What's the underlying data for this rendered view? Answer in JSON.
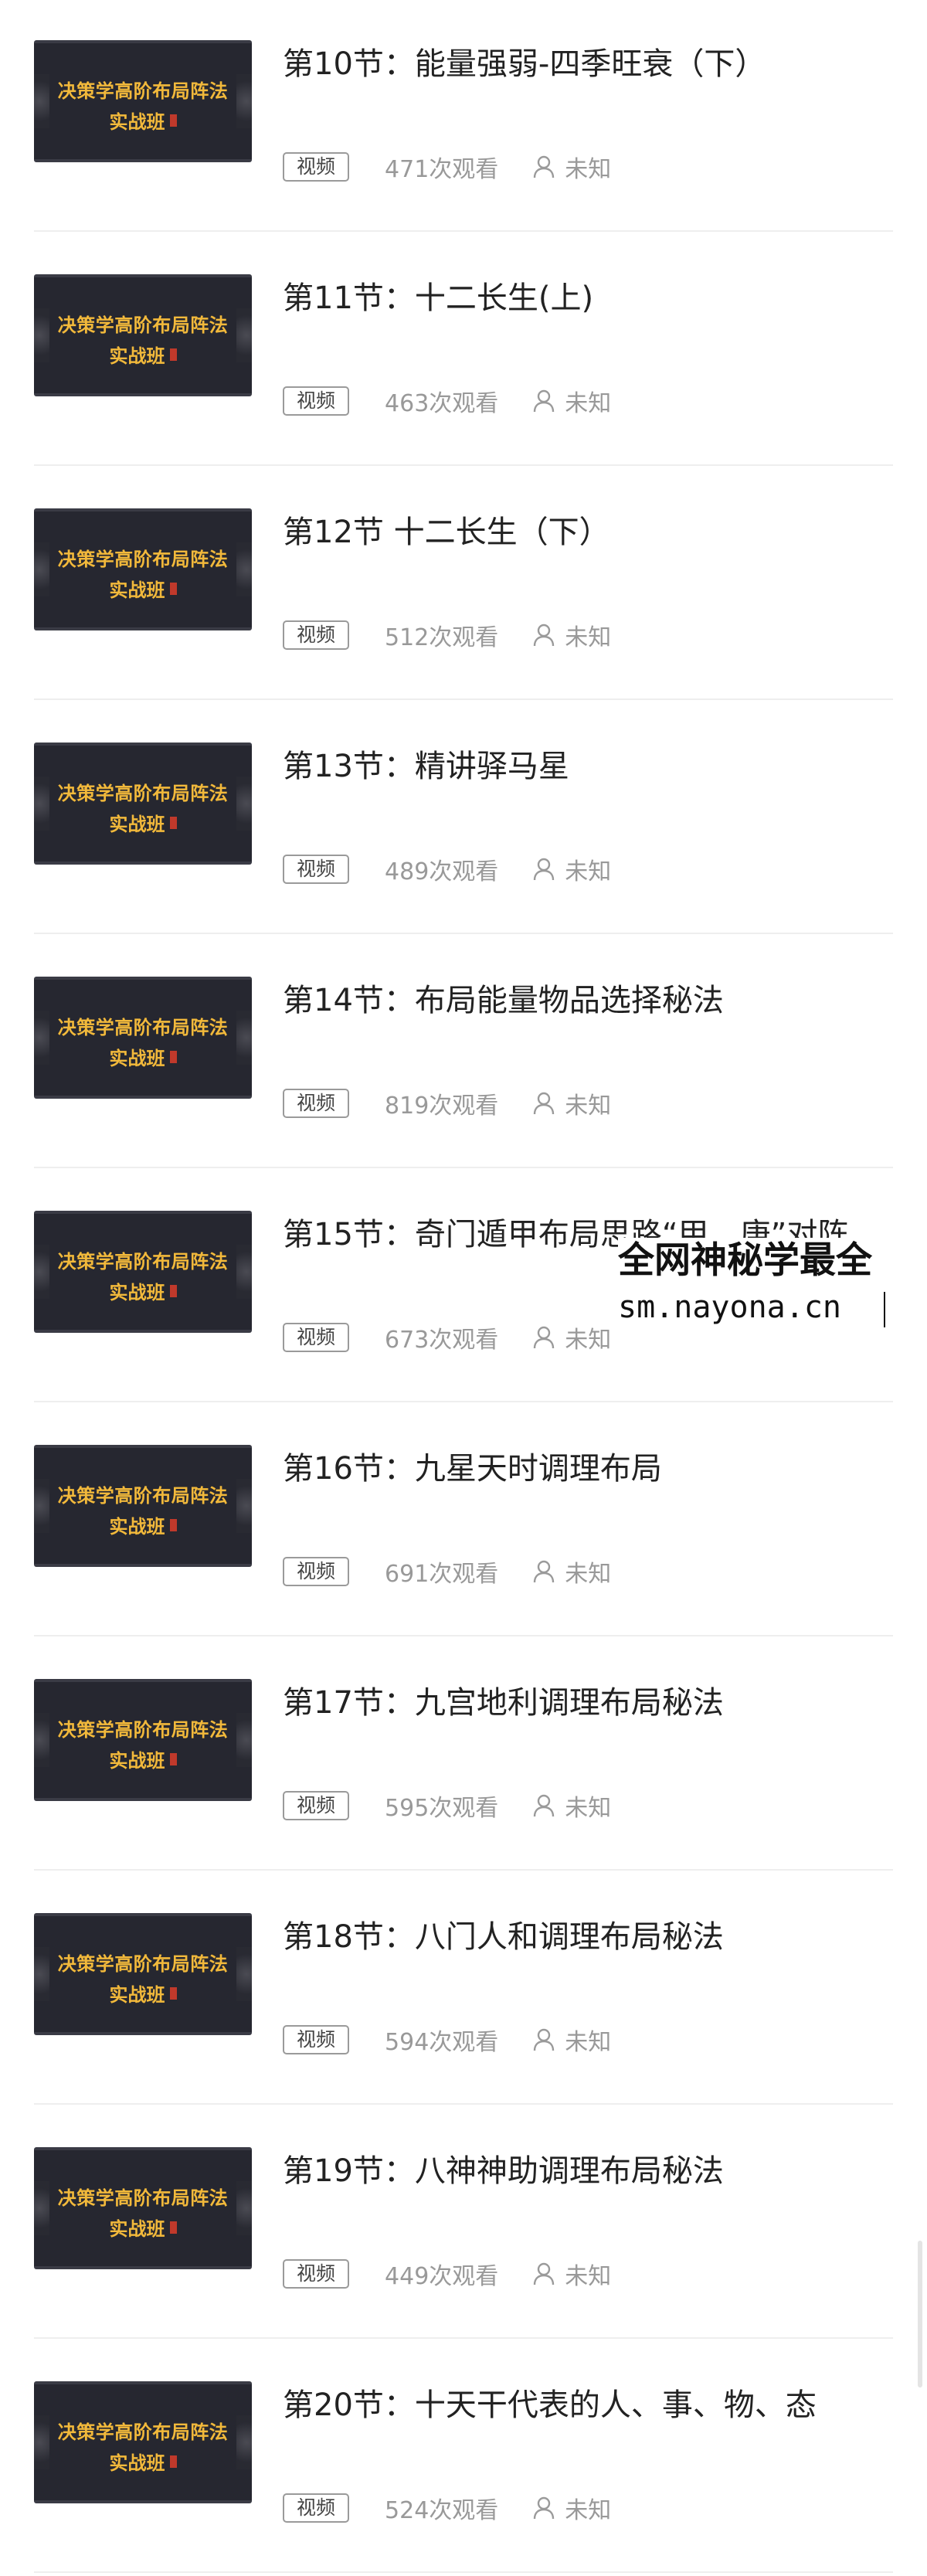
{
  "thumbnail": {
    "line1": "决策学高阶布局阵法",
    "line2": "实战班"
  },
  "lessons": [
    {
      "title": "第10节：能量强弱-四季旺衰（下）",
      "tag": "视频",
      "views": "471次观看",
      "author": "未知"
    },
    {
      "title": "第11节：十二长生(上)",
      "tag": "视频",
      "views": "463次观看",
      "author": "未知"
    },
    {
      "title": "第12节 十二长生（下）",
      "tag": "视频",
      "views": "512次观看",
      "author": "未知"
    },
    {
      "title": "第13节：精讲驿马星",
      "tag": "视频",
      "views": "489次观看",
      "author": "未知"
    },
    {
      "title": "第14节：布局能量物品选择秘法",
      "tag": "视频",
      "views": "819次观看",
      "author": "未知"
    },
    {
      "title": "第15节：奇门遁甲布局思路“甲、庚”对阵",
      "tag": "视频",
      "views": "673次观看",
      "author": "未知"
    },
    {
      "title": "第16节：九星天时调理布局",
      "tag": "视频",
      "views": "691次观看",
      "author": "未知"
    },
    {
      "title": "第17节：九宫地利调理布局秘法",
      "tag": "视频",
      "views": "595次观看",
      "author": "未知"
    },
    {
      "title": "第18节：八门人和调理布局秘法",
      "tag": "视频",
      "views": "594次观看",
      "author": "未知"
    },
    {
      "title": "第19节：八神神助调理布局秘法",
      "tag": "视频",
      "views": "449次观看",
      "author": "未知"
    },
    {
      "title": "第20节：十天干代表的人、事、物、态",
      "tag": "视频",
      "views": "524次观看",
      "author": "未知"
    }
  ],
  "watermark": {
    "line1": "全网神秘学最全",
    "line2": "sm.nayona.cn"
  }
}
